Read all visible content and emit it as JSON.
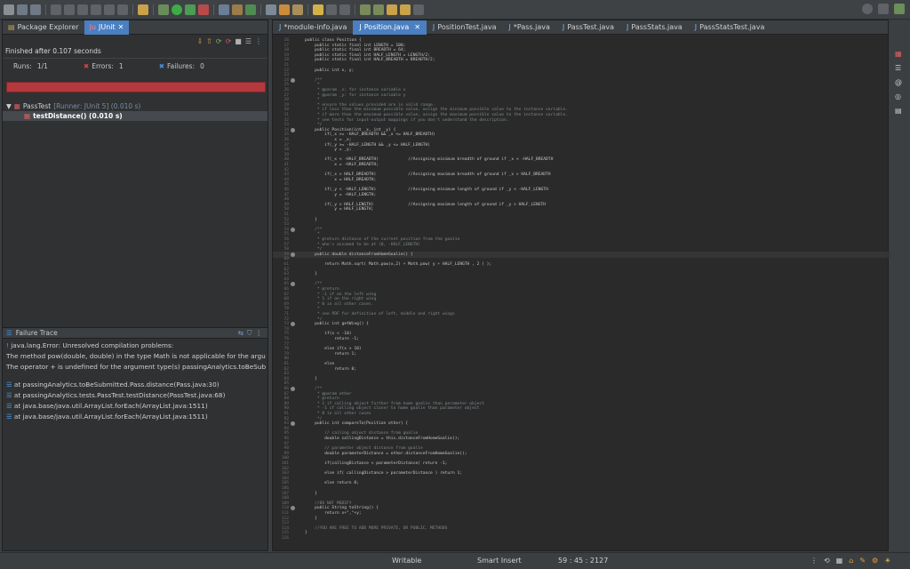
{
  "colors": {
    "accent": "#4a7fc1",
    "failure_bar": "#b5383d",
    "editor_bg": "#2a2a2a"
  },
  "left_tabs": [
    {
      "label": "Package Explorer",
      "icon": "package-explorer-icon"
    },
    {
      "label": "JUnit",
      "icon": "junit-icon"
    }
  ],
  "junit": {
    "finished": "Finished after 0.107 seconds",
    "runs_label": "Runs:",
    "runs_value": "1/1",
    "errors_label": "Errors:",
    "errors_value": "1",
    "failures_label": "Failures:",
    "failures_value": "0",
    "progress": 1.0,
    "tree": [
      {
        "label": "PassTest",
        "suffix": "[Runner: JUnit 5] (0.010 s)"
      },
      {
        "label": "testDistance() (0.010 s)",
        "suffix": ""
      }
    ],
    "trace_title": "Failure Trace",
    "trace_lines": [
      "java.lang.Error: Unresolved compilation problems:",
      "The method pow(double, double) in the type Math is not applicable for the argu",
      "The operator + is undefined for the argument type(s) passingAnalytics.toBeSub",
      "",
      "at passingAnalytics.toBeSubmitted.Pass.distance(Pass.java:30)",
      "at passingAnalytics.tests.PassTest.testDistance(PassTest.java:68)",
      "at java.base/java.util.ArrayList.forEach(ArrayList.java:1511)",
      "at java.base/java.util.ArrayList.forEach(ArrayList.java:1511)"
    ]
  },
  "editor_tabs": [
    {
      "label": "*module-info.java",
      "active": false
    },
    {
      "label": "Position.java",
      "active": true
    },
    {
      "label": "PositionTest.java",
      "active": false
    },
    {
      "label": "*Pass.java",
      "active": false
    },
    {
      "label": "PassTest.java",
      "active": false
    },
    {
      "label": "PassStats.java",
      "active": false
    },
    {
      "label": "PassStatsTest.java",
      "active": false
    }
  ],
  "code_lines": [
    {
      "n": "16",
      "t": "public class Position {"
    },
    {
      "n": "17",
      "t": "    public static final int LENGTH = 100;"
    },
    {
      "n": "18",
      "t": "    public static final int BREADTH = 64;"
    },
    {
      "n": "19",
      "t": "    public static final int HALF_LENGTH = LENGTH/2;"
    },
    {
      "n": "20",
      "t": "    public static final int HALF_BREADTH = BREADTH/2;"
    },
    {
      "n": "21",
      "t": ""
    },
    {
      "n": "22",
      "t": "    public int x, y;"
    },
    {
      "n": "23",
      "t": ""
    },
    {
      "n": "24",
      "t": "    /**"
    },
    {
      "n": "25",
      "t": "     *"
    },
    {
      "n": "26",
      "t": "     * @param _x: for instance variable x"
    },
    {
      "n": "27",
      "t": "     * @param _y: for instance variable y"
    },
    {
      "n": "28",
      "t": "     *"
    },
    {
      "n": "29",
      "t": "     * ensure the values provided are in valid range."
    },
    {
      "n": "30",
      "t": "     * if less than the minimum possible value, assign the minimum possible value to the instance variable."
    },
    {
      "n": "31",
      "t": "     * if more than the maximum possible value, assign the maximum possible value to the instance variable."
    },
    {
      "n": "32",
      "t": "     * see tests for input-output mappings if you don't understand the description."
    },
    {
      "n": "33",
      "t": "     */"
    },
    {
      "n": "34",
      "t": "    public Position(int _x, int _y) {"
    },
    {
      "n": "35",
      "t": "        if(_x >= -HALF_BREADTH && _x <= HALF_BREADTH)"
    },
    {
      "n": "36",
      "t": "            x = _x;"
    },
    {
      "n": "37",
      "t": "        if(_y >= -HALF_LENGTH && _y <= HALF_LENGTH)"
    },
    {
      "n": "38",
      "t": "            y = _y;"
    },
    {
      "n": "39",
      "t": ""
    },
    {
      "n": "40",
      "t": "        if(_x < -HALF_BREADTH)            //Assigning minimum breadth of ground if _x < -HALF_BREADTH"
    },
    {
      "n": "41",
      "t": "            x = -HALF_BREADTH;"
    },
    {
      "n": "42",
      "t": ""
    },
    {
      "n": "43",
      "t": "        if(_x > HALF_BREADTH)             //Assigning maximum breadth of ground if _x > HALF_BREADTH"
    },
    {
      "n": "44",
      "t": "            x = HALF_BREADTH;"
    },
    {
      "n": "45",
      "t": ""
    },
    {
      "n": "46",
      "t": "        if(_y < -HALF_LENGTH)             //Assigning minimum length of ground if _y < -HALF_LENGTH"
    },
    {
      "n": "47",
      "t": "            y = -HALF_LENGTH;"
    },
    {
      "n": "48",
      "t": ""
    },
    {
      "n": "49",
      "t": "        if(_y > HALF_LENGTH)              //Assigning maximum length of ground if _y > HALF_LENGTH"
    },
    {
      "n": "50",
      "t": "            y = HALF_LENGTH;"
    },
    {
      "n": "51",
      "t": ""
    },
    {
      "n": "52",
      "t": "    }"
    },
    {
      "n": "53",
      "t": ""
    },
    {
      "n": "54",
      "t": "    /**"
    },
    {
      "n": "55",
      "t": "     *"
    },
    {
      "n": "56",
      "t": "     * @return distance of the current position from the goalie"
    },
    {
      "n": "57",
      "t": "     * who's assumed to be at (0, -HALF_LENGTH)"
    },
    {
      "n": "58",
      "t": "     */"
    },
    {
      "n": "59",
      "t": "    public double distanceFromHomeGoalie() {"
    },
    {
      "n": "60",
      "t": ""
    },
    {
      "n": "61",
      "t": "        return Math.sqrt( Math.pow(x,2) + Math.pow( y + HALF_LENGTH , 2 ) );"
    },
    {
      "n": "62",
      "t": ""
    },
    {
      "n": "63",
      "t": "    }"
    },
    {
      "n": "64",
      "t": ""
    },
    {
      "n": "65",
      "t": "    /**"
    },
    {
      "n": "66",
      "t": "     * @return"
    },
    {
      "n": "67",
      "t": "     * -1 if on the left wing"
    },
    {
      "n": "68",
      "t": "     * 1 if on the right wing"
    },
    {
      "n": "69",
      "t": "     * 0 in all other cases."
    },
    {
      "n": "70",
      "t": "     *"
    },
    {
      "n": "71",
      "t": "     * see PDF for definition of left, middle and right wings"
    },
    {
      "n": "72",
      "t": "     */"
    },
    {
      "n": "73",
      "t": "    public int getWing() {"
    },
    {
      "n": "74",
      "t": ""
    },
    {
      "n": "75",
      "t": "        if(x < -10)"
    },
    {
      "n": "76",
      "t": "            return -1;"
    },
    {
      "n": "77",
      "t": ""
    },
    {
      "n": "78",
      "t": "        else if(x > 10)"
    },
    {
      "n": "79",
      "t": "            return 1;"
    },
    {
      "n": "80",
      "t": ""
    },
    {
      "n": "81",
      "t": "        else"
    },
    {
      "n": "82",
      "t": "            return 0;"
    },
    {
      "n": "83",
      "t": ""
    },
    {
      "n": "84",
      "t": "    }"
    },
    {
      "n": "85",
      "t": ""
    },
    {
      "n": "86",
      "t": "    /**"
    },
    {
      "n": "87",
      "t": "     * @param other"
    },
    {
      "n": "88",
      "t": "     * @return"
    },
    {
      "n": "89",
      "t": "     * 1 if calling object further from home goalie than parameter object"
    },
    {
      "n": "90",
      "t": "     * -1 if calling object closer to home goalie than parameter object"
    },
    {
      "n": "91",
      "t": "     * 0 in all other cases"
    },
    {
      "n": "92",
      "t": "     */"
    },
    {
      "n": "93",
      "t": "    public int compareTo(Position other) {"
    },
    {
      "n": "94",
      "t": ""
    },
    {
      "n": "95",
      "t": "        // calling object distance from goalie"
    },
    {
      "n": "96",
      "t": "        double callingDistance = this.distanceFromHomeGoalie();"
    },
    {
      "n": "97",
      "t": ""
    },
    {
      "n": "98",
      "t": "        // parameter object distance from goalie"
    },
    {
      "n": "99",
      "t": "        double parameterDistance = other.distanceFromHomeGoalie();"
    },
    {
      "n": "100",
      "t": ""
    },
    {
      "n": "101",
      "t": "        if(callingDistance < parameterDistance) return -1;"
    },
    {
      "n": "102",
      "t": ""
    },
    {
      "n": "103",
      "t": "        else if( callingDistance > parameterDistance ) return 1;"
    },
    {
      "n": "104",
      "t": ""
    },
    {
      "n": "105",
      "t": "        else return 0;"
    },
    {
      "n": "106",
      "t": ""
    },
    {
      "n": "107",
      "t": "    }"
    },
    {
      "n": "108",
      "t": ""
    },
    {
      "n": "109",
      "t": "    //DO NOT MODIFY"
    },
    {
      "n": "110",
      "t": "    public String toString() {"
    },
    {
      "n": "111",
      "t": "        return x+\",\"+y;"
    },
    {
      "n": "112",
      "t": "    }"
    },
    {
      "n": "113",
      "t": ""
    },
    {
      "n": "114",
      "t": "    //YOU ARE FREE TO ADD MORE PRIVATE, OR PUBLIC, METHODS"
    },
    {
      "n": "115",
      "t": "}"
    },
    {
      "n": "116",
      "t": ""
    }
  ],
  "status": {
    "writable": "Writable",
    "insert_mode": "Smart Insert",
    "position": "59 : 45 : 2127"
  }
}
